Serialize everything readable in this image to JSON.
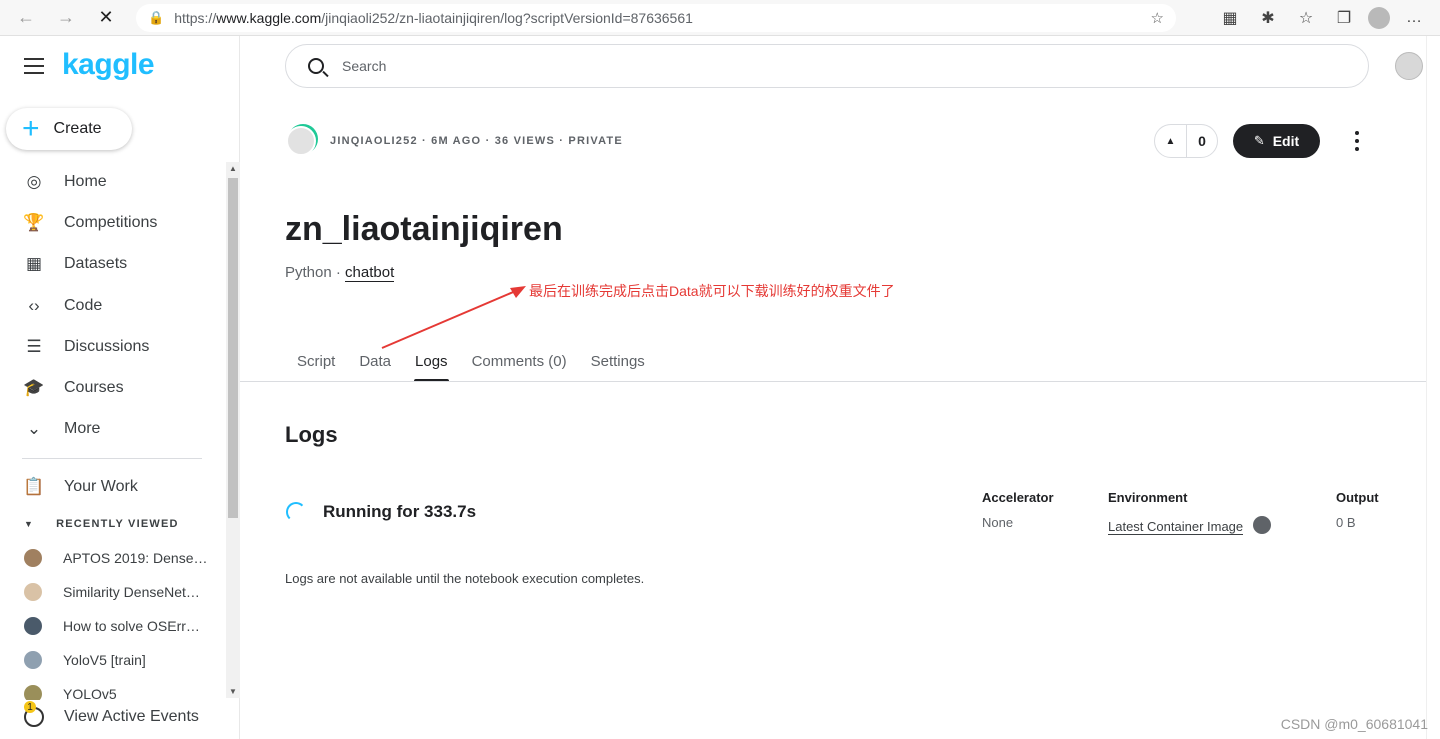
{
  "browser": {
    "url_prefix": "https://",
    "url_host": "www.kaggle.com",
    "url_path": "/jinqiaoli252/zn-liaotainjiqiren/log?scriptVersionId=87636561"
  },
  "sidebar": {
    "logo": "kaggle",
    "create_label": "Create",
    "items": [
      {
        "label": "Home",
        "icon": "compass-icon"
      },
      {
        "label": "Competitions",
        "icon": "trophy-icon"
      },
      {
        "label": "Datasets",
        "icon": "table-icon"
      },
      {
        "label": "Code",
        "icon": "code-icon"
      },
      {
        "label": "Discussions",
        "icon": "comments-icon"
      },
      {
        "label": "Courses",
        "icon": "school-icon"
      },
      {
        "label": "More",
        "icon": "chevron-down-icon"
      }
    ],
    "your_work": "Your Work",
    "recently_viewed_heading": "RECENTLY VIEWED",
    "recent": [
      "APTOS 2019: Dense…",
      "Similarity DenseNet…",
      "How to solve OSErr…",
      "YoloV5 [train]",
      "YOLOv5"
    ],
    "active_events": "View Active Events",
    "active_events_badge": "1"
  },
  "header": {
    "search_placeholder": "Search"
  },
  "notebook": {
    "meta": "JINQIAOLI252 · 6M AGO · 36 VIEWS · PRIVATE",
    "vote_count": "0",
    "edit_label": "Edit",
    "title": "zn_liaotainjiqiren",
    "language": "Python · ",
    "tag": "chatbot",
    "annotation": "最后在训练完成后点击Data就可以下载训练好的权重文件了"
  },
  "tabs": [
    "Script",
    "Data",
    "Logs",
    "Comments (0)",
    "Settings"
  ],
  "logs": {
    "heading": "Logs",
    "running": "Running for 333.7s",
    "accelerator_label": "Accelerator",
    "accelerator_value": "None",
    "environment_label": "Environment",
    "environment_value": "Latest Container Image",
    "output_label": "Output",
    "output_value": "0 B",
    "notice": "Logs are not available until the notebook execution completes."
  },
  "watermark": "CSDN @m0_60681041",
  "colors": {
    "kaggle_blue": "#20beff",
    "annotation_red": "#e53935"
  }
}
